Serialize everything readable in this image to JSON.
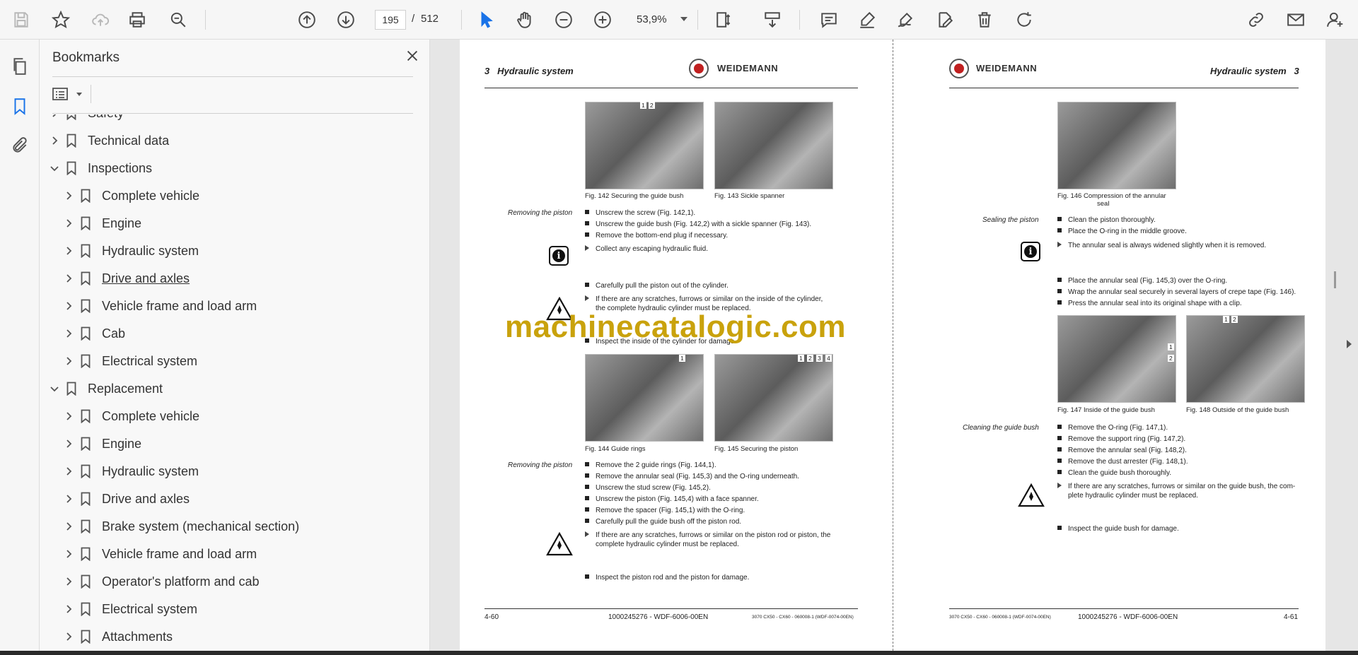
{
  "toolbar": {
    "icons": [
      "save-icon",
      "star-icon",
      "cloud-upload-icon",
      "print-icon",
      "zoom-search-icon",
      "page-up-icon",
      "page-down-icon",
      "select-arrow-icon",
      "hand-icon",
      "zoom-out-icon",
      "zoom-in-icon",
      "fit-page-icon",
      "scroll-mode-icon",
      "comment-icon",
      "highlight-icon",
      "sign-icon",
      "edit-icon",
      "delete-icon",
      "rotate-icon",
      "share-link-icon",
      "email-icon",
      "account-icon"
    ],
    "page_current": "195",
    "page_separator": "/",
    "page_total": "512",
    "zoom_value": "53,9%"
  },
  "bookmarks": {
    "title": "Bookmarks",
    "items": [
      {
        "label": "Safety",
        "level": 0,
        "expanded": false
      },
      {
        "label": "Technical data",
        "level": 0,
        "expanded": false
      },
      {
        "label": "Inspections",
        "level": 0,
        "expanded": true
      },
      {
        "label": "Complete vehicle",
        "level": 1,
        "expanded": false
      },
      {
        "label": "Engine",
        "level": 1,
        "expanded": false
      },
      {
        "label": "Hydraulic system",
        "level": 1,
        "expanded": false
      },
      {
        "label": "Drive and axles",
        "level": 1,
        "expanded": false
      },
      {
        "label": "Vehicle frame and load arm",
        "level": 1,
        "expanded": false
      },
      {
        "label": "Cab",
        "level": 1,
        "expanded": false
      },
      {
        "label": "Electrical system",
        "level": 1,
        "expanded": false
      },
      {
        "label": "Replacement",
        "level": 0,
        "expanded": true
      },
      {
        "label": "Complete vehicle",
        "level": 1,
        "expanded": false
      },
      {
        "label": "Engine",
        "level": 1,
        "expanded": false
      },
      {
        "label": "Hydraulic system",
        "level": 1,
        "expanded": false
      },
      {
        "label": "Drive and axles",
        "level": 1,
        "expanded": false
      },
      {
        "label": "Brake system (mechanical section)",
        "level": 1,
        "expanded": false
      },
      {
        "label": "Vehicle frame and load arm",
        "level": 1,
        "expanded": false
      },
      {
        "label": "Operator's platform and cab",
        "level": 1,
        "expanded": false
      },
      {
        "label": "Electrical system",
        "level": 1,
        "expanded": false
      },
      {
        "label": "Attachments",
        "level": 1,
        "expanded": false
      }
    ]
  },
  "left_page": {
    "chapter": "3",
    "title": "Hydraulic system",
    "brand": "WEIDEMANN",
    "fig142": {
      "caption": "Fig. 142   Securing the guide bush",
      "callouts": [
        "1",
        "2"
      ]
    },
    "fig143": {
      "caption": "Fig. 143   Sickle spanner"
    },
    "sec1_label": "Removing the piston",
    "sec1_lines": [
      "Unscrew the screw (Fig. 142,1).",
      "Unscrew the guide bush (Fig. 142,2) with a sickle spanner (Fig. 143).",
      "Remove the bottom-end plug if necessary.",
      "Collect any escaping hydraulic fluid.",
      "Carefully pull the piston out of the cylinder.",
      "If there are any scratches, furrows or similar on the inside of the cylinder,",
      "the complete hydraulic cylinder must be replaced.",
      "Inspect the inside of the cylinder for damage."
    ],
    "fig144": {
      "caption": "Fig. 144   Guide rings",
      "callouts": [
        "1"
      ]
    },
    "fig145": {
      "caption": "Fig. 145   Securing the piston",
      "callouts": [
        "1",
        "2",
        "3",
        "4"
      ]
    },
    "sec2_label": "Removing the piston",
    "sec2_lines": [
      "Remove the 2 guide rings (Fig. 144,1).",
      "Remove the annular seal (Fig. 145,3) and the O-ring underneath.",
      "Unscrew the stud screw (Fig. 145,2).",
      "Unscrew the piston (Fig. 145,4) with a face spanner.",
      "Remove the spacer (Fig. 145,1) with the O-ring.",
      "Carefully pull the guide bush off the piston rod.",
      "If there are any scratches, furrows or similar on the piston rod or piston, the",
      "complete hydraulic cylinder must be replaced.",
      "Inspect the piston rod and the piston for damage."
    ],
    "footer_left": "4-60",
    "footer_center": "1000245276 - WDF-6006-00EN",
    "footer_right": "3070 CX50 - CX60 - 060008-1 (WDF-0074-00EN)"
  },
  "right_page": {
    "brand": "WEIDEMANN",
    "title": "Hydraulic system",
    "chapter": "3",
    "fig146": {
      "caption_1": "Fig. 146   Compression of the annular",
      "caption_2": "seal"
    },
    "sec1_label": "Sealing the piston",
    "sec1_lines": [
      "Clean the piston thoroughly.",
      "Place the O-ring in the middle groove.",
      "The annular seal is always widened slightly when it is removed.",
      "Place the annular seal (Fig. 145,3) over the O-ring.",
      "Wrap the annular seal securely in several layers of crepe tape (Fig. 146).",
      "Press the annular seal into its original shape with a clip."
    ],
    "fig147": {
      "caption": "Fig. 147   Inside of the guide bush",
      "callouts": [
        "1",
        "2"
      ]
    },
    "fig148": {
      "caption": "Fig. 148   Outside of the guide bush",
      "callouts": [
        "1",
        "2"
      ]
    },
    "sec2_label": "Cleaning the guide bush",
    "sec2_lines": [
      "Remove the O-ring (Fig. 147,1).",
      "Remove the support ring (Fig. 147,2).",
      "Remove the annular seal (Fig. 148,2).",
      "Remove the dust arrester (Fig. 148,1).",
      "Clean the guide bush thoroughly.",
      "If there are any scratches, furrows or similar on the guide bush, the com-",
      "plete hydraulic cylinder must be replaced.",
      "Inspect the guide bush for damage."
    ],
    "footer_left": "3070 CX50 - CX60 - 060008-1 (WDF-0074-00EN)",
    "footer_center": "1000245276 - WDF-6006-00EN",
    "footer_right": "4-61"
  },
  "watermark": "machinecatalogic.com"
}
